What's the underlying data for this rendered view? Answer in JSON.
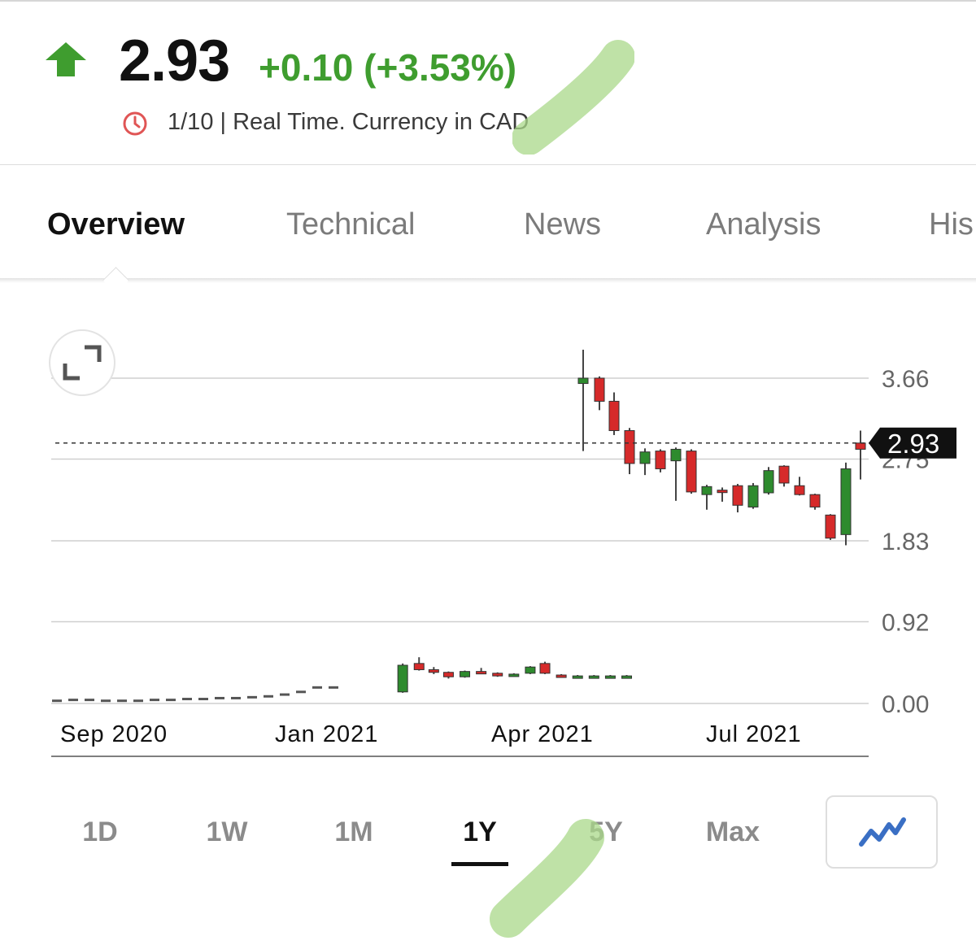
{
  "quote": {
    "price": "2.93",
    "change": "+0.10 (+3.53%)",
    "status": "1/10 | Real Time. Currency in CAD",
    "direction_icon": "up-arrow-icon",
    "up_color": "#3f9d2f",
    "clock_color": "#e05555"
  },
  "tabs": [
    {
      "label": "Overview",
      "active": true
    },
    {
      "label": "Technical",
      "active": false
    },
    {
      "label": "News",
      "active": false
    },
    {
      "label": "Analysis",
      "active": false
    },
    {
      "label": "His",
      "active": false
    }
  ],
  "chart_data": {
    "type": "candlestick",
    "x_labels": [
      "Sep 2020",
      "Jan 2021",
      "Apr 2021",
      "Jul 2021"
    ],
    "y_ticks": [
      "3.66",
      "2.75",
      "1.83",
      "0.92",
      "0.00"
    ],
    "ylim": [
      0,
      3.66
    ],
    "grid": true,
    "current_price_label": "2.93",
    "current_price": 2.93,
    "up_color": "#2e8b2e",
    "down_color": "#d62a2a",
    "candles": [
      {
        "date": "2020-08-07",
        "o": 0.02,
        "h": 0.04,
        "l": 0.01,
        "c": 0.03
      },
      {
        "date": "2020-08-21",
        "o": 0.03,
        "h": 0.05,
        "l": 0.02,
        "c": 0.04
      },
      {
        "date": "2020-09-04",
        "o": 0.04,
        "h": 0.05,
        "l": 0.03,
        "c": 0.04
      },
      {
        "date": "2020-09-18",
        "o": 0.04,
        "h": 0.04,
        "l": 0.03,
        "c": 0.03
      },
      {
        "date": "2020-10-02",
        "o": 0.03,
        "h": 0.04,
        "l": 0.03,
        "c": 0.03
      },
      {
        "date": "2020-10-16",
        "o": 0.03,
        "h": 0.04,
        "l": 0.03,
        "c": 0.03
      },
      {
        "date": "2020-10-30",
        "o": 0.03,
        "h": 0.04,
        "l": 0.03,
        "c": 0.04
      },
      {
        "date": "2020-11-13",
        "o": 0.04,
        "h": 0.05,
        "l": 0.03,
        "c": 0.04
      },
      {
        "date": "2020-11-27",
        "o": 0.04,
        "h": 0.05,
        "l": 0.04,
        "c": 0.05
      },
      {
        "date": "2020-12-11",
        "o": 0.05,
        "h": 0.06,
        "l": 0.04,
        "c": 0.05
      },
      {
        "date": "2020-12-25",
        "o": 0.05,
        "h": 0.06,
        "l": 0.04,
        "c": 0.06
      },
      {
        "date": "2021-01-08",
        "o": 0.06,
        "h": 0.07,
        "l": 0.05,
        "c": 0.06
      },
      {
        "date": "2021-01-22",
        "o": 0.06,
        "h": 0.07,
        "l": 0.05,
        "c": 0.07
      },
      {
        "date": "2021-02-05",
        "o": 0.07,
        "h": 0.09,
        "l": 0.06,
        "c": 0.08
      },
      {
        "date": "2021-02-19",
        "o": 0.08,
        "h": 0.11,
        "l": 0.06,
        "c": 0.1
      },
      {
        "date": "2021-03-05",
        "o": 0.1,
        "h": 0.14,
        "l": 0.09,
        "c": 0.13
      },
      {
        "date": "2021-03-19",
        "o": 0.13,
        "h": 0.2,
        "l": 0.12,
        "c": 0.18
      }
    ],
    "candles_visible": [
      {
        "x": 0.43,
        "o": 0.13,
        "h": 0.45,
        "l": 0.12,
        "c": 0.43
      },
      {
        "x": 0.45,
        "o": 0.45,
        "h": 0.52,
        "l": 0.37,
        "c": 0.38
      },
      {
        "x": 0.468,
        "o": 0.38,
        "h": 0.41,
        "l": 0.33,
        "c": 0.35
      },
      {
        "x": 0.486,
        "o": 0.35,
        "h": 0.36,
        "l": 0.28,
        "c": 0.3
      },
      {
        "x": 0.506,
        "o": 0.3,
        "h": 0.37,
        "l": 0.29,
        "c": 0.36
      },
      {
        "x": 0.526,
        "o": 0.36,
        "h": 0.4,
        "l": 0.33,
        "c": 0.34
      },
      {
        "x": 0.546,
        "o": 0.34,
        "h": 0.35,
        "l": 0.3,
        "c": 0.31
      },
      {
        "x": 0.566,
        "o": 0.32,
        "h": 0.34,
        "l": 0.31,
        "c": 0.33
      },
      {
        "x": 0.586,
        "o": 0.34,
        "h": 0.42,
        "l": 0.33,
        "c": 0.41
      },
      {
        "x": 0.604,
        "o": 0.45,
        "h": 0.47,
        "l": 0.33,
        "c": 0.34
      },
      {
        "x": 0.624,
        "o": 0.32,
        "h": 0.33,
        "l": 0.3,
        "c": 0.31
      },
      {
        "x": 0.644,
        "o": 0.31,
        "h": 0.32,
        "l": 0.3,
        "c": 0.31
      },
      {
        "x": 0.664,
        "o": 0.31,
        "h": 0.32,
        "l": 0.3,
        "c": 0.31
      },
      {
        "x": 0.684,
        "o": 0.31,
        "h": 0.32,
        "l": 0.3,
        "c": 0.31
      },
      {
        "x": 0.704,
        "o": 0.31,
        "h": 0.32,
        "l": 0.3,
        "c": 0.31
      }
    ]
  },
  "periods": [
    {
      "label": "1D",
      "active": false
    },
    {
      "label": "1W",
      "active": false
    },
    {
      "label": "1M",
      "active": false
    },
    {
      "label": "1Y",
      "active": true
    },
    {
      "label": "5Y",
      "active": false
    },
    {
      "label": "Max",
      "active": false
    }
  ],
  "chart_type_icon": "line-chart-icon",
  "expand_icon": "expand-icon",
  "line_icon_color": "#3a6fc4"
}
